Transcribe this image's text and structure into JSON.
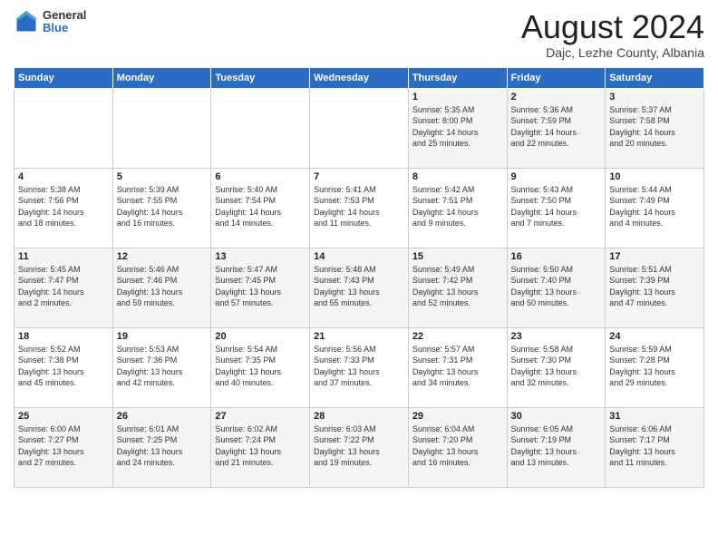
{
  "header": {
    "logo_general": "General",
    "logo_blue": "Blue",
    "month_title": "August 2024",
    "subtitle": "Dajc, Lezhe County, Albania"
  },
  "weekdays": [
    "Sunday",
    "Monday",
    "Tuesday",
    "Wednesday",
    "Thursday",
    "Friday",
    "Saturday"
  ],
  "weeks": [
    [
      {
        "day": "",
        "info": ""
      },
      {
        "day": "",
        "info": ""
      },
      {
        "day": "",
        "info": ""
      },
      {
        "day": "",
        "info": ""
      },
      {
        "day": "1",
        "info": "Sunrise: 5:35 AM\nSunset: 8:00 PM\nDaylight: 14 hours\nand 25 minutes."
      },
      {
        "day": "2",
        "info": "Sunrise: 5:36 AM\nSunset: 7:59 PM\nDaylight: 14 hours\nand 22 minutes."
      },
      {
        "day": "3",
        "info": "Sunrise: 5:37 AM\nSunset: 7:58 PM\nDaylight: 14 hours\nand 20 minutes."
      }
    ],
    [
      {
        "day": "4",
        "info": "Sunrise: 5:38 AM\nSunset: 7:56 PM\nDaylight: 14 hours\nand 18 minutes."
      },
      {
        "day": "5",
        "info": "Sunrise: 5:39 AM\nSunset: 7:55 PM\nDaylight: 14 hours\nand 16 minutes."
      },
      {
        "day": "6",
        "info": "Sunrise: 5:40 AM\nSunset: 7:54 PM\nDaylight: 14 hours\nand 14 minutes."
      },
      {
        "day": "7",
        "info": "Sunrise: 5:41 AM\nSunset: 7:53 PM\nDaylight: 14 hours\nand 11 minutes."
      },
      {
        "day": "8",
        "info": "Sunrise: 5:42 AM\nSunset: 7:51 PM\nDaylight: 14 hours\nand 9 minutes."
      },
      {
        "day": "9",
        "info": "Sunrise: 5:43 AM\nSunset: 7:50 PM\nDaylight: 14 hours\nand 7 minutes."
      },
      {
        "day": "10",
        "info": "Sunrise: 5:44 AM\nSunset: 7:49 PM\nDaylight: 14 hours\nand 4 minutes."
      }
    ],
    [
      {
        "day": "11",
        "info": "Sunrise: 5:45 AM\nSunset: 7:47 PM\nDaylight: 14 hours\nand 2 minutes."
      },
      {
        "day": "12",
        "info": "Sunrise: 5:46 AM\nSunset: 7:46 PM\nDaylight: 13 hours\nand 59 minutes."
      },
      {
        "day": "13",
        "info": "Sunrise: 5:47 AM\nSunset: 7:45 PM\nDaylight: 13 hours\nand 57 minutes."
      },
      {
        "day": "14",
        "info": "Sunrise: 5:48 AM\nSunset: 7:43 PM\nDaylight: 13 hours\nand 55 minutes."
      },
      {
        "day": "15",
        "info": "Sunrise: 5:49 AM\nSunset: 7:42 PM\nDaylight: 13 hours\nand 52 minutes."
      },
      {
        "day": "16",
        "info": "Sunrise: 5:50 AM\nSunset: 7:40 PM\nDaylight: 13 hours\nand 50 minutes."
      },
      {
        "day": "17",
        "info": "Sunrise: 5:51 AM\nSunset: 7:39 PM\nDaylight: 13 hours\nand 47 minutes."
      }
    ],
    [
      {
        "day": "18",
        "info": "Sunrise: 5:52 AM\nSunset: 7:38 PM\nDaylight: 13 hours\nand 45 minutes."
      },
      {
        "day": "19",
        "info": "Sunrise: 5:53 AM\nSunset: 7:36 PM\nDaylight: 13 hours\nand 42 minutes."
      },
      {
        "day": "20",
        "info": "Sunrise: 5:54 AM\nSunset: 7:35 PM\nDaylight: 13 hours\nand 40 minutes."
      },
      {
        "day": "21",
        "info": "Sunrise: 5:56 AM\nSunset: 7:33 PM\nDaylight: 13 hours\nand 37 minutes."
      },
      {
        "day": "22",
        "info": "Sunrise: 5:57 AM\nSunset: 7:31 PM\nDaylight: 13 hours\nand 34 minutes."
      },
      {
        "day": "23",
        "info": "Sunrise: 5:58 AM\nSunset: 7:30 PM\nDaylight: 13 hours\nand 32 minutes."
      },
      {
        "day": "24",
        "info": "Sunrise: 5:59 AM\nSunset: 7:28 PM\nDaylight: 13 hours\nand 29 minutes."
      }
    ],
    [
      {
        "day": "25",
        "info": "Sunrise: 6:00 AM\nSunset: 7:27 PM\nDaylight: 13 hours\nand 27 minutes."
      },
      {
        "day": "26",
        "info": "Sunrise: 6:01 AM\nSunset: 7:25 PM\nDaylight: 13 hours\nand 24 minutes."
      },
      {
        "day": "27",
        "info": "Sunrise: 6:02 AM\nSunset: 7:24 PM\nDaylight: 13 hours\nand 21 minutes."
      },
      {
        "day": "28",
        "info": "Sunrise: 6:03 AM\nSunset: 7:22 PM\nDaylight: 13 hours\nand 19 minutes."
      },
      {
        "day": "29",
        "info": "Sunrise: 6:04 AM\nSunset: 7:20 PM\nDaylight: 13 hours\nand 16 minutes."
      },
      {
        "day": "30",
        "info": "Sunrise: 6:05 AM\nSunset: 7:19 PM\nDaylight: 13 hours\nand 13 minutes."
      },
      {
        "day": "31",
        "info": "Sunrise: 6:06 AM\nSunset: 7:17 PM\nDaylight: 13 hours\nand 11 minutes."
      }
    ]
  ]
}
